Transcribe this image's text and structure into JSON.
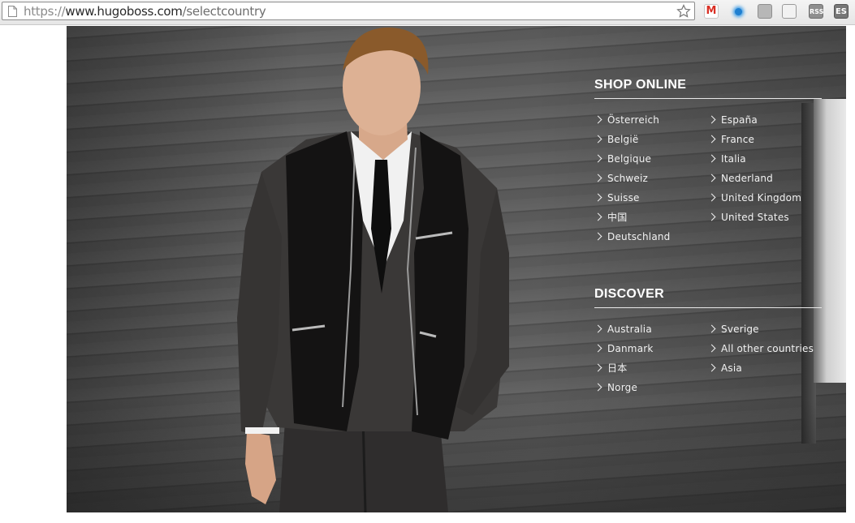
{
  "browser": {
    "url_scheme": "https://",
    "url_host": "www.hugoboss.com",
    "url_path": "/selectcountry",
    "extensions": [
      "gmail-icon",
      "globe-icon",
      "disk-icon",
      "book-icon",
      "rss-icon",
      "es-icon"
    ],
    "ext_rss_label": "RSS",
    "ext_es_label": "ES"
  },
  "shop_online": {
    "title": "SHOP ONLINE",
    "left": [
      "Österreich",
      "België",
      "Belgique",
      "Schweiz",
      "Suisse",
      "中国",
      "Deutschland"
    ],
    "right": [
      "España",
      "France",
      "Italia",
      "Nederland",
      "United Kingdom",
      "United States"
    ]
  },
  "discover": {
    "title": "DISCOVER",
    "left": [
      "Australia",
      "Danmark",
      "日本",
      "Norge"
    ],
    "right": [
      "Sverige",
      "All other countries",
      "Asia"
    ]
  },
  "colors": {
    "panel_text": "#ffffff",
    "wall": "#5a5a5a",
    "gmail_red": "#d93025"
  }
}
